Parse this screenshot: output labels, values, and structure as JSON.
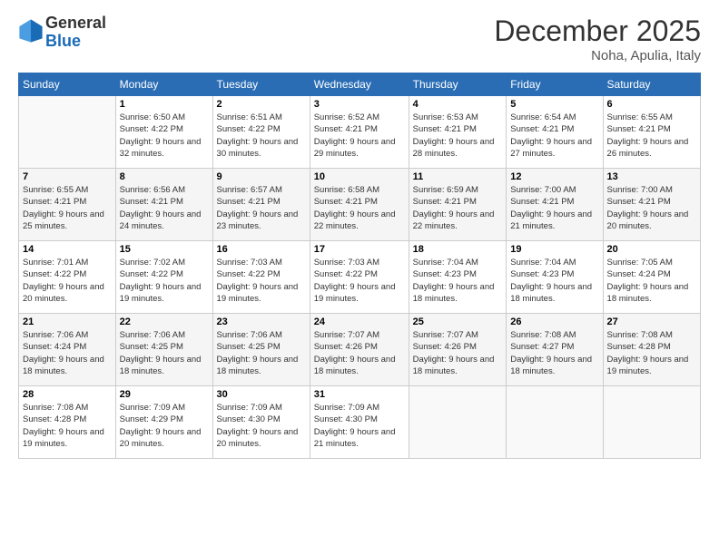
{
  "logo": {
    "general": "General",
    "blue": "Blue"
  },
  "header": {
    "title": "December 2025",
    "location": "Noha, Apulia, Italy"
  },
  "days_of_week": [
    "Sunday",
    "Monday",
    "Tuesday",
    "Wednesday",
    "Thursday",
    "Friday",
    "Saturday"
  ],
  "weeks": [
    [
      {
        "day": "",
        "sunrise": "",
        "sunset": "",
        "daylight": ""
      },
      {
        "day": "1",
        "sunrise": "Sunrise: 6:50 AM",
        "sunset": "Sunset: 4:22 PM",
        "daylight": "Daylight: 9 hours and 32 minutes."
      },
      {
        "day": "2",
        "sunrise": "Sunrise: 6:51 AM",
        "sunset": "Sunset: 4:22 PM",
        "daylight": "Daylight: 9 hours and 30 minutes."
      },
      {
        "day": "3",
        "sunrise": "Sunrise: 6:52 AM",
        "sunset": "Sunset: 4:21 PM",
        "daylight": "Daylight: 9 hours and 29 minutes."
      },
      {
        "day": "4",
        "sunrise": "Sunrise: 6:53 AM",
        "sunset": "Sunset: 4:21 PM",
        "daylight": "Daylight: 9 hours and 28 minutes."
      },
      {
        "day": "5",
        "sunrise": "Sunrise: 6:54 AM",
        "sunset": "Sunset: 4:21 PM",
        "daylight": "Daylight: 9 hours and 27 minutes."
      },
      {
        "day": "6",
        "sunrise": "Sunrise: 6:55 AM",
        "sunset": "Sunset: 4:21 PM",
        "daylight": "Daylight: 9 hours and 26 minutes."
      }
    ],
    [
      {
        "day": "7",
        "sunrise": "Sunrise: 6:55 AM",
        "sunset": "Sunset: 4:21 PM",
        "daylight": "Daylight: 9 hours and 25 minutes."
      },
      {
        "day": "8",
        "sunrise": "Sunrise: 6:56 AM",
        "sunset": "Sunset: 4:21 PM",
        "daylight": "Daylight: 9 hours and 24 minutes."
      },
      {
        "day": "9",
        "sunrise": "Sunrise: 6:57 AM",
        "sunset": "Sunset: 4:21 PM",
        "daylight": "Daylight: 9 hours and 23 minutes."
      },
      {
        "day": "10",
        "sunrise": "Sunrise: 6:58 AM",
        "sunset": "Sunset: 4:21 PM",
        "daylight": "Daylight: 9 hours and 22 minutes."
      },
      {
        "day": "11",
        "sunrise": "Sunrise: 6:59 AM",
        "sunset": "Sunset: 4:21 PM",
        "daylight": "Daylight: 9 hours and 22 minutes."
      },
      {
        "day": "12",
        "sunrise": "Sunrise: 7:00 AM",
        "sunset": "Sunset: 4:21 PM",
        "daylight": "Daylight: 9 hours and 21 minutes."
      },
      {
        "day": "13",
        "sunrise": "Sunrise: 7:00 AM",
        "sunset": "Sunset: 4:21 PM",
        "daylight": "Daylight: 9 hours and 20 minutes."
      }
    ],
    [
      {
        "day": "14",
        "sunrise": "Sunrise: 7:01 AM",
        "sunset": "Sunset: 4:22 PM",
        "daylight": "Daylight: 9 hours and 20 minutes."
      },
      {
        "day": "15",
        "sunrise": "Sunrise: 7:02 AM",
        "sunset": "Sunset: 4:22 PM",
        "daylight": "Daylight: 9 hours and 19 minutes."
      },
      {
        "day": "16",
        "sunrise": "Sunrise: 7:03 AM",
        "sunset": "Sunset: 4:22 PM",
        "daylight": "Daylight: 9 hours and 19 minutes."
      },
      {
        "day": "17",
        "sunrise": "Sunrise: 7:03 AM",
        "sunset": "Sunset: 4:22 PM",
        "daylight": "Daylight: 9 hours and 19 minutes."
      },
      {
        "day": "18",
        "sunrise": "Sunrise: 7:04 AM",
        "sunset": "Sunset: 4:23 PM",
        "daylight": "Daylight: 9 hours and 18 minutes."
      },
      {
        "day": "19",
        "sunrise": "Sunrise: 7:04 AM",
        "sunset": "Sunset: 4:23 PM",
        "daylight": "Daylight: 9 hours and 18 minutes."
      },
      {
        "day": "20",
        "sunrise": "Sunrise: 7:05 AM",
        "sunset": "Sunset: 4:24 PM",
        "daylight": "Daylight: 9 hours and 18 minutes."
      }
    ],
    [
      {
        "day": "21",
        "sunrise": "Sunrise: 7:06 AM",
        "sunset": "Sunset: 4:24 PM",
        "daylight": "Daylight: 9 hours and 18 minutes."
      },
      {
        "day": "22",
        "sunrise": "Sunrise: 7:06 AM",
        "sunset": "Sunset: 4:25 PM",
        "daylight": "Daylight: 9 hours and 18 minutes."
      },
      {
        "day": "23",
        "sunrise": "Sunrise: 7:06 AM",
        "sunset": "Sunset: 4:25 PM",
        "daylight": "Daylight: 9 hours and 18 minutes."
      },
      {
        "day": "24",
        "sunrise": "Sunrise: 7:07 AM",
        "sunset": "Sunset: 4:26 PM",
        "daylight": "Daylight: 9 hours and 18 minutes."
      },
      {
        "day": "25",
        "sunrise": "Sunrise: 7:07 AM",
        "sunset": "Sunset: 4:26 PM",
        "daylight": "Daylight: 9 hours and 18 minutes."
      },
      {
        "day": "26",
        "sunrise": "Sunrise: 7:08 AM",
        "sunset": "Sunset: 4:27 PM",
        "daylight": "Daylight: 9 hours and 18 minutes."
      },
      {
        "day": "27",
        "sunrise": "Sunrise: 7:08 AM",
        "sunset": "Sunset: 4:28 PM",
        "daylight": "Daylight: 9 hours and 19 minutes."
      }
    ],
    [
      {
        "day": "28",
        "sunrise": "Sunrise: 7:08 AM",
        "sunset": "Sunset: 4:28 PM",
        "daylight": "Daylight: 9 hours and 19 minutes."
      },
      {
        "day": "29",
        "sunrise": "Sunrise: 7:09 AM",
        "sunset": "Sunset: 4:29 PM",
        "daylight": "Daylight: 9 hours and 20 minutes."
      },
      {
        "day": "30",
        "sunrise": "Sunrise: 7:09 AM",
        "sunset": "Sunset: 4:30 PM",
        "daylight": "Daylight: 9 hours and 20 minutes."
      },
      {
        "day": "31",
        "sunrise": "Sunrise: 7:09 AM",
        "sunset": "Sunset: 4:30 PM",
        "daylight": "Daylight: 9 hours and 21 minutes."
      },
      {
        "day": "",
        "sunrise": "",
        "sunset": "",
        "daylight": ""
      },
      {
        "day": "",
        "sunrise": "",
        "sunset": "",
        "daylight": ""
      },
      {
        "day": "",
        "sunrise": "",
        "sunset": "",
        "daylight": ""
      }
    ]
  ]
}
